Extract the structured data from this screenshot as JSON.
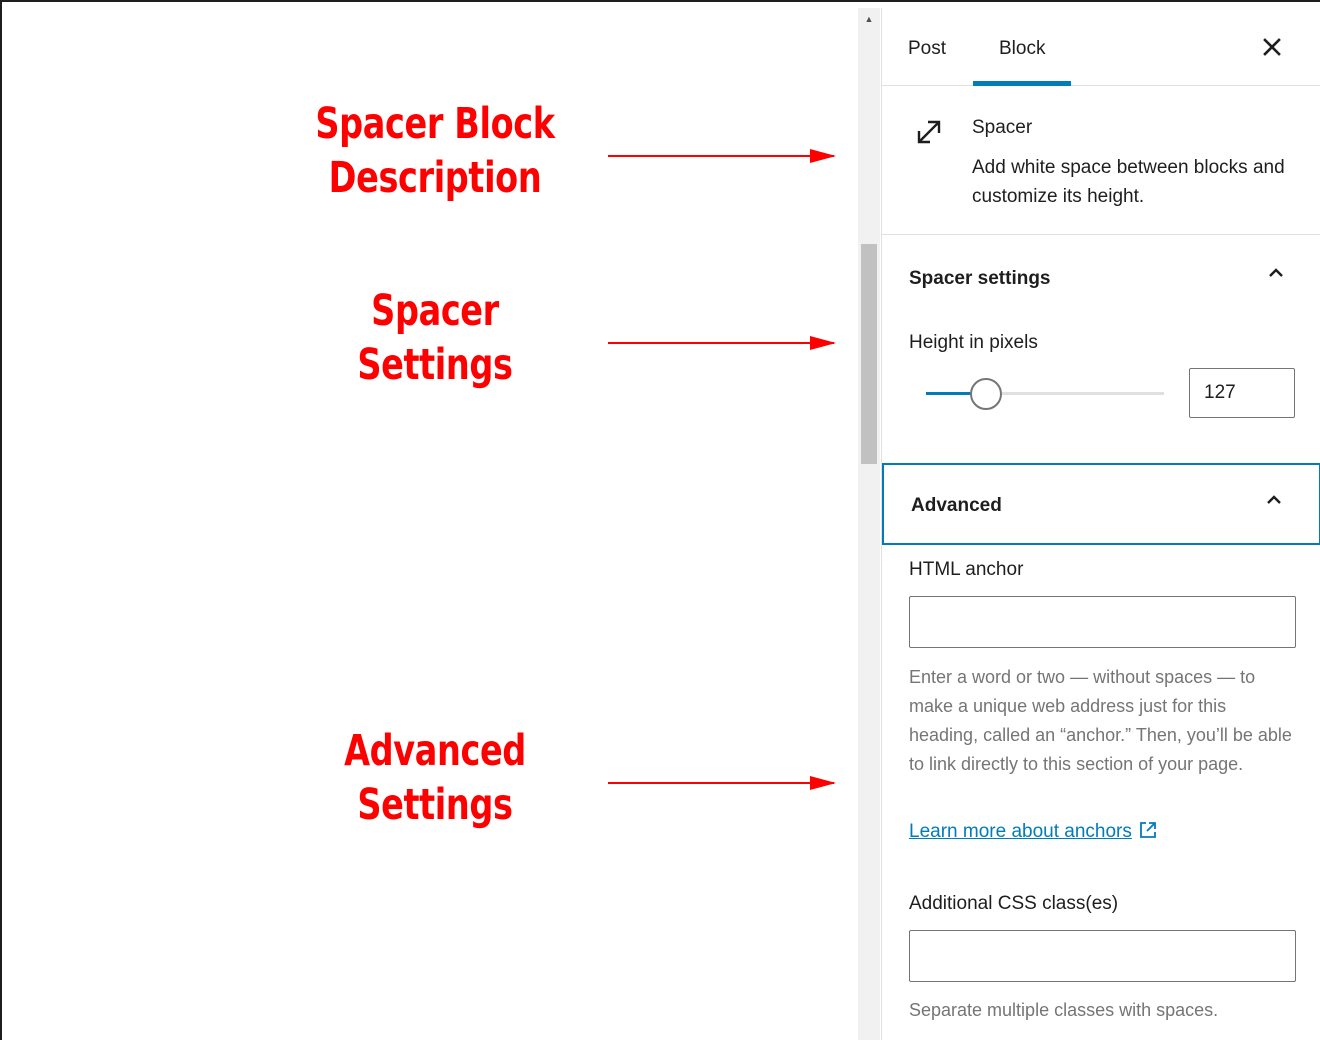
{
  "annotations": {
    "block_description": [
      "Spacer Block",
      "Description"
    ],
    "spacer_settings": [
      "Spacer",
      "Settings"
    ],
    "advanced_settings": [
      "Advanced",
      "Settings"
    ]
  },
  "sidebar": {
    "tabs": [
      {
        "label": "Post",
        "active": false
      },
      {
        "label": "Block",
        "active": true
      }
    ],
    "close_icon": "close-icon",
    "block": {
      "icon": "resize-arrows-icon",
      "title": "Spacer",
      "description": "Add white space between blocks and customize its height."
    },
    "spacer_settings": {
      "title": "Spacer settings",
      "expanded": true,
      "height_label": "Height in pixels",
      "height_value": "127",
      "slider_fraction": 0.25
    },
    "advanced": {
      "title": "Advanced",
      "expanded": true,
      "html_anchor_label": "HTML anchor",
      "html_anchor_value": "",
      "html_anchor_help": "Enter a word or two — without spaces — to make a unique web address just for this heading, called an “anchor.” Then, you’ll be able to link directly to this section of your page.",
      "learn_more_link": "Learn more about anchors",
      "css_class_label": "Additional CSS class(es)",
      "css_class_value": "",
      "css_class_help": "Separate multiple classes with spaces."
    }
  },
  "colors": {
    "accent": "#007cba",
    "annotation": "#ff0000"
  }
}
